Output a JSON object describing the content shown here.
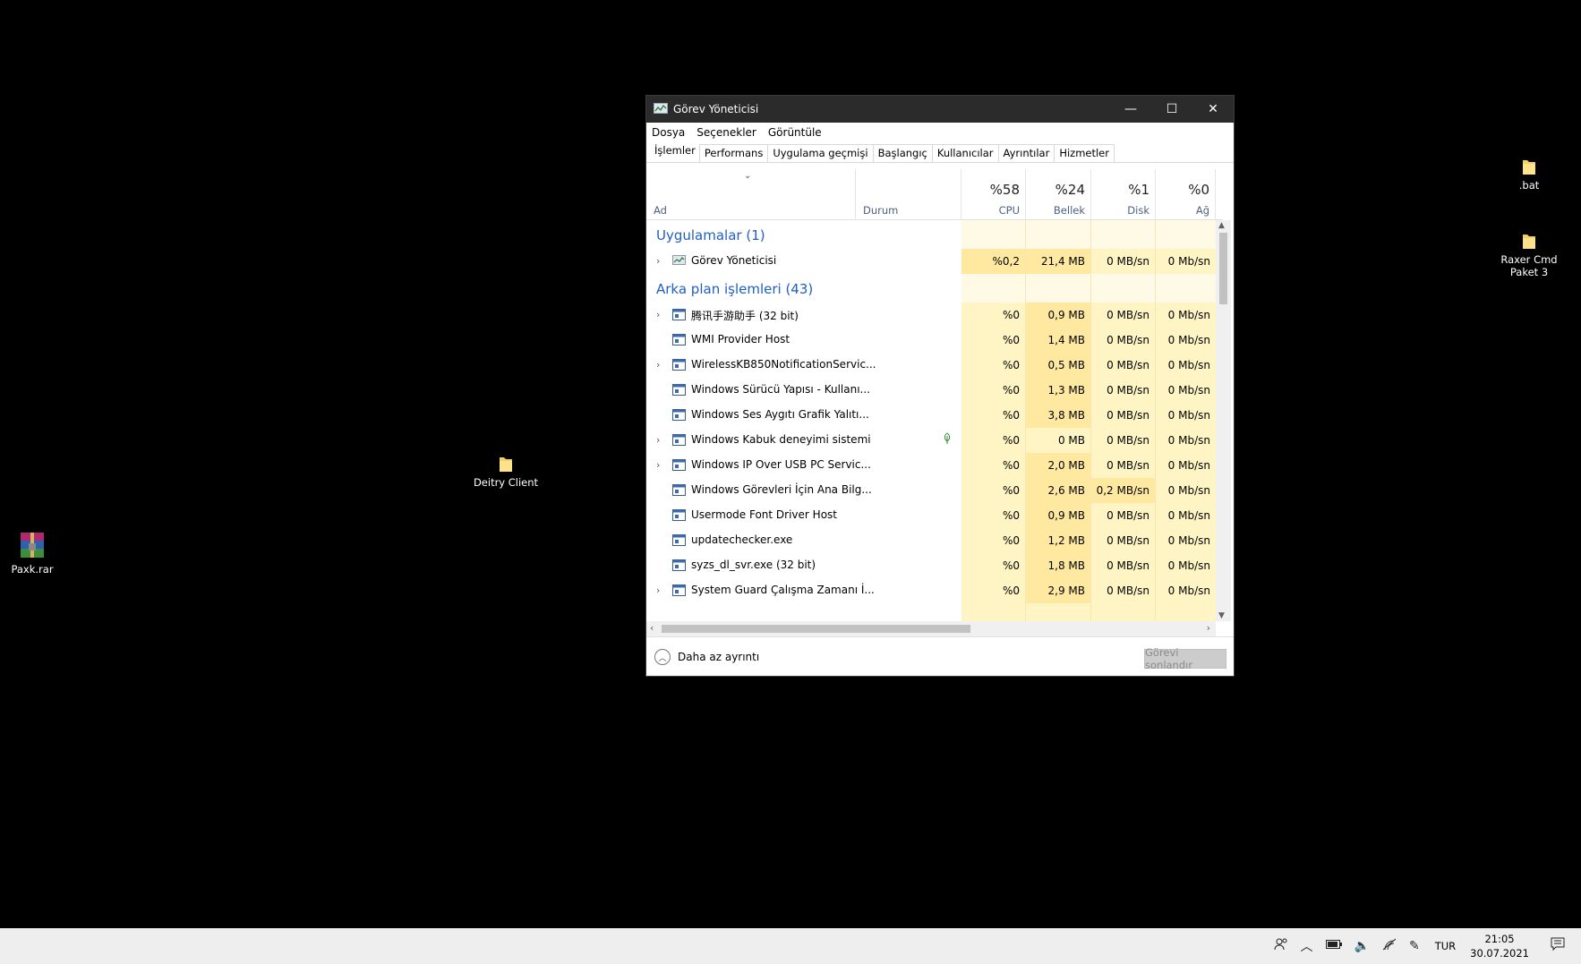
{
  "desktop": {
    "icons": [
      {
        "label": ".bat"
      },
      {
        "label": "Raxer Cmd Paket 3"
      },
      {
        "label": "Deitry Client"
      },
      {
        "label": "Paxk.rar"
      }
    ]
  },
  "window": {
    "title": "Görev Yöneticisi",
    "controls": {
      "minimize": "—",
      "maximize": "☐",
      "close": "✕"
    },
    "menu": [
      "Dosya",
      "Seçenekler",
      "Görüntüle"
    ],
    "tabs": [
      "İşlemler",
      "Performans",
      "Uygulama geçmişi",
      "Başlangıç",
      "Kullanıcılar",
      "Ayrıntılar",
      "Hizmetler"
    ],
    "active_tab": "İşlemler",
    "columns": {
      "name": "Ad",
      "status": "Durum",
      "cpu": {
        "pct": "%58",
        "label": "CPU"
      },
      "memory": {
        "pct": "%24",
        "label": "Bellek"
      },
      "disk": {
        "pct": "%1",
        "label": "Disk"
      },
      "network": {
        "pct": "%0",
        "label": "Ağ"
      }
    },
    "groups": [
      {
        "title": "Uygulamalar (1)"
      },
      {
        "title": "Arka plan işlemleri (43)"
      }
    ],
    "apps": [
      {
        "name": "Görev Yöneticisi",
        "cpu": "%0,2",
        "mem": "21,4 MB",
        "disk": "0 MB/sn",
        "net": "0 Mb/sn",
        "expand": true
      }
    ],
    "background": [
      {
        "name": "腾讯手游助手 (32 bit)",
        "cpu": "%0",
        "mem": "0,9 MB",
        "disk": "0 MB/sn",
        "net": "0 Mb/sn",
        "expand": true
      },
      {
        "name": "WMI Provider Host",
        "cpu": "%0",
        "mem": "1,4 MB",
        "disk": "0 MB/sn",
        "net": "0 Mb/sn",
        "expand": false
      },
      {
        "name": "WirelessKB850NotificationServic...",
        "cpu": "%0",
        "mem": "0,5 MB",
        "disk": "0 MB/sn",
        "net": "0 Mb/sn",
        "expand": true
      },
      {
        "name": "Windows Sürücü Yapısı - Kullanı...",
        "cpu": "%0",
        "mem": "1,3 MB",
        "disk": "0 MB/sn",
        "net": "0 Mb/sn",
        "expand": false
      },
      {
        "name": "Windows Ses Aygıtı Grafik Yalıtı...",
        "cpu": "%0",
        "mem": "3,8 MB",
        "disk": "0 MB/sn",
        "net": "0 Mb/sn",
        "expand": false
      },
      {
        "name": "Windows Kabuk deneyimi sistemi",
        "cpu": "%0",
        "mem": "0 MB",
        "disk": "0 MB/sn",
        "net": "0 Mb/sn",
        "expand": true,
        "status_icon": "leaf-icon"
      },
      {
        "name": "Windows IP Over USB PC Servic...",
        "cpu": "%0",
        "mem": "2,0 MB",
        "disk": "0 MB/sn",
        "net": "0 Mb/sn",
        "expand": true
      },
      {
        "name": "Windows Görevleri İçin Ana Bilg...",
        "cpu": "%0",
        "mem": "2,6 MB",
        "disk": "0,2 MB/sn",
        "net": "0 Mb/sn",
        "expand": false
      },
      {
        "name": "Usermode Font Driver Host",
        "cpu": "%0",
        "mem": "0,9 MB",
        "disk": "0 MB/sn",
        "net": "0 Mb/sn",
        "expand": false
      },
      {
        "name": "updatechecker.exe",
        "cpu": "%0",
        "mem": "1,2 MB",
        "disk": "0 MB/sn",
        "net": "0 Mb/sn",
        "expand": false
      },
      {
        "name": "syzs_dl_svr.exe (32 bit)",
        "cpu": "%0",
        "mem": "1,8 MB",
        "disk": "0 MB/sn",
        "net": "0 Mb/sn",
        "expand": false
      },
      {
        "name": "System Guard Çalışma Zamanı İ...",
        "cpu": "%0",
        "mem": "2,9 MB",
        "disk": "0 MB/sn",
        "net": "0 Mb/sn",
        "expand": true
      }
    ],
    "footer": {
      "less_details": "Daha az ayrıntı",
      "end_task": "Görevi sonlandır"
    }
  },
  "taskbar": {
    "language": "TUR",
    "time": "21:05",
    "date": "30.07.2021"
  }
}
